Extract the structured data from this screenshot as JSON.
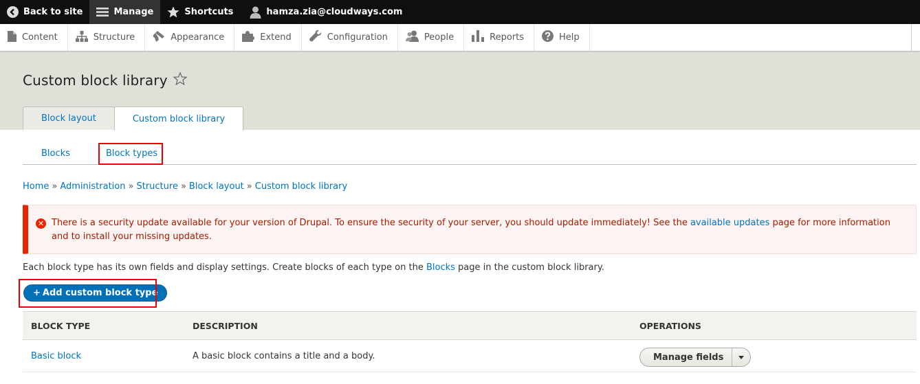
{
  "toolbar": {
    "back_label": "Back to site",
    "manage_label": "Manage",
    "shortcuts_label": "Shortcuts",
    "user_label": "hamza.zia@cloudways.com"
  },
  "tray": {
    "items": [
      {
        "label": "Content",
        "icon": "file-icon"
      },
      {
        "label": "Structure",
        "icon": "sitemap-icon"
      },
      {
        "label": "Appearance",
        "icon": "paintbrush-icon"
      },
      {
        "label": "Extend",
        "icon": "puzzle-icon"
      },
      {
        "label": "Configuration",
        "icon": "wrench-icon"
      },
      {
        "label": "People",
        "icon": "people-icon"
      },
      {
        "label": "Reports",
        "icon": "bar-chart-icon"
      },
      {
        "label": "Help",
        "icon": "help-icon"
      }
    ]
  },
  "page": {
    "title": "Custom block library"
  },
  "tabs": {
    "primary": [
      "Block layout",
      "Custom block library"
    ],
    "secondary": [
      "Blocks",
      "Block types"
    ]
  },
  "breadcrumb": [
    "Home",
    "Administration",
    "Structure",
    "Block layout",
    "Custom block library"
  ],
  "alert": {
    "text_before": "There is a security update available for your version of Drupal. To ensure the security of your server, you should update immediately! See the ",
    "link": "available updates",
    "text_after": " page for more information and to install your missing updates."
  },
  "description": {
    "before": "Each block type has its own fields and display settings. Create blocks of each type on the ",
    "link": "Blocks",
    "after": " page in the custom block library."
  },
  "add_button": {
    "plus": "+",
    "label": "Add custom block type"
  },
  "table": {
    "headers": [
      "BLOCK TYPE",
      "DESCRIPTION",
      "OPERATIONS"
    ],
    "rows": [
      {
        "type": "Basic block",
        "description": "A basic block contains a title and a body.",
        "operation": "Manage fields"
      }
    ]
  },
  "colors": {
    "link": "#0074bd",
    "error": "#e62600",
    "primary_button": "#0071b8",
    "highlight": "#e00000"
  }
}
